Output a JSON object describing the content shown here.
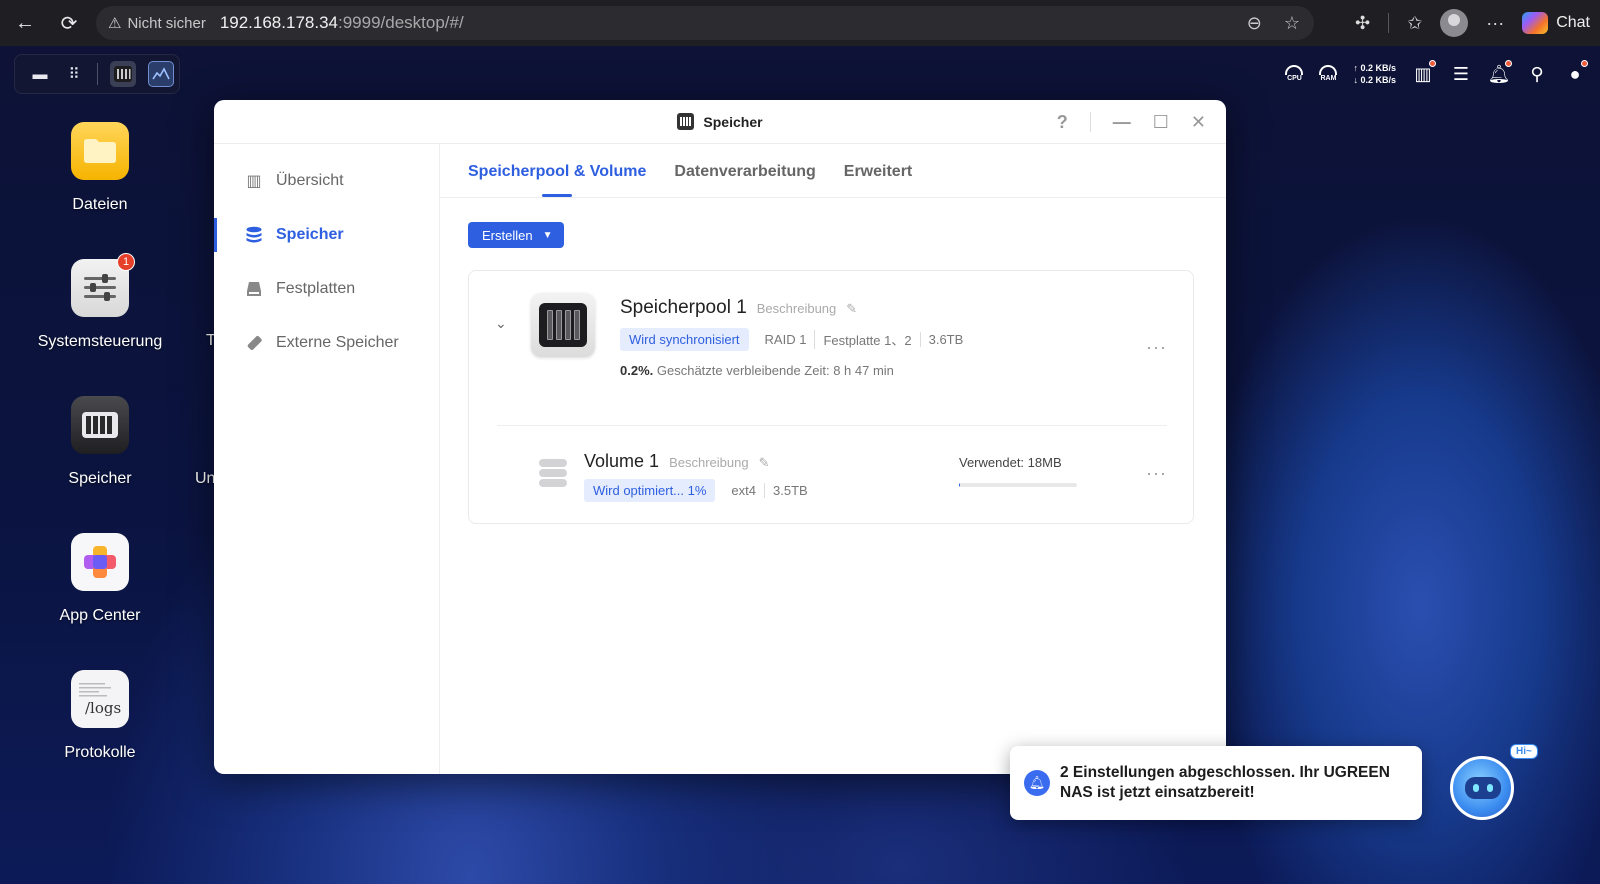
{
  "browser": {
    "insecure_label": "Nicht sicher",
    "url_host": "192.168.178.34",
    "url_path": ":9999/desktop/#/",
    "chat_label": "Chat"
  },
  "tray": {
    "cpu_label": "CPU",
    "ram_label": "RAM",
    "upload": "↑ 0.2 KB/s",
    "download": "↓ 0.2 KB/s"
  },
  "desktop": {
    "icons": [
      {
        "label": "Dateien"
      },
      {
        "label": "Systemsteuerung",
        "badge": "1"
      },
      {
        "label": "Speicher"
      },
      {
        "label": "App Center"
      },
      {
        "label": "Protokolle",
        "img_text": "/logs"
      }
    ],
    "partial_labels": [
      "T",
      "Un"
    ]
  },
  "window": {
    "title": "Speicher",
    "help": "?",
    "sidebar": [
      {
        "label": "Übersicht",
        "active": false
      },
      {
        "label": "Speicher",
        "active": true
      },
      {
        "label": "Festplatten",
        "active": false
      },
      {
        "label": "Externe Speicher",
        "active": false
      }
    ],
    "tabs": [
      {
        "label": "Speicherpool & Volume",
        "active": true
      },
      {
        "label": "Datenverarbeitung",
        "active": false
      },
      {
        "label": "Erweitert",
        "active": false
      }
    ],
    "create_button": "Erstellen",
    "pool": {
      "name": "Speicherpool 1",
      "description_placeholder": "Beschreibung",
      "status": "Wird synchronisiert",
      "raid": "RAID 1",
      "disks": "Festplatte 1、2",
      "capacity": "3.6TB",
      "progress_pct": "0.2%.",
      "progress_text": "Geschätzte verbleibende Zeit: 8 h 47 min"
    },
    "volume": {
      "name": "Volume 1",
      "description_placeholder": "Beschreibung",
      "status": "Wird optimiert... 1%",
      "fs": "ext4",
      "capacity": "3.5TB",
      "used_label": "Verwendet: 18MB",
      "used_fraction": 0.005
    }
  },
  "notification": {
    "text": "2 Einstellungen abgeschlossen. Ihr UGREEN NAS ist jetzt einsatzbereit!",
    "assistant_hi": "Hi~"
  },
  "colors": {
    "accent": "#2e5fe0",
    "badge": "#e5402a"
  }
}
